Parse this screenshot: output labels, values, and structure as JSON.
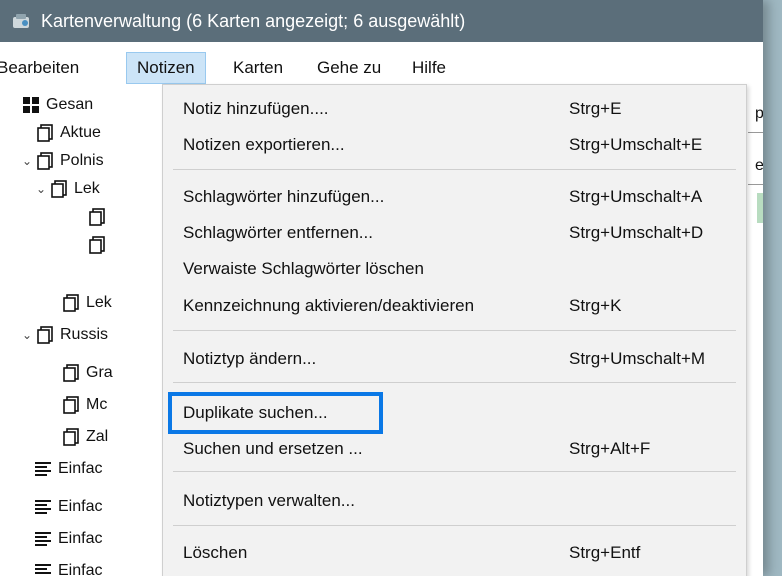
{
  "window": {
    "title": "Kartenverwaltung (6 Karten angezeigt; 6 ausgewählt)"
  },
  "menubar": {
    "items": [
      {
        "label": "Bearbeiten"
      },
      {
        "label": "Notizen"
      },
      {
        "label": "Karten"
      },
      {
        "label": "Gehe zu"
      },
      {
        "label": "Hilfe"
      }
    ]
  },
  "sidebar": {
    "items": [
      {
        "label": "Gesan",
        "icon": "grid-icon"
      },
      {
        "label": "Aktue",
        "icon": "cards-icon"
      },
      {
        "label": "Polnis",
        "icon": "cards-icon"
      },
      {
        "label": "Lek",
        "icon": "cards-icon"
      },
      {
        "label": "",
        "icon": "cards-icon"
      },
      {
        "label": "",
        "icon": "cards-icon"
      },
      {
        "label": "Lek",
        "icon": "cards-icon"
      },
      {
        "label": "Russis",
        "icon": "cards-icon"
      },
      {
        "label": "Gra",
        "icon": "cards-icon"
      },
      {
        "label": "Mc",
        "icon": "cards-icon"
      },
      {
        "label": "Zal",
        "icon": "cards-icon"
      },
      {
        "label": "Einfac",
        "icon": "notetype-icon"
      },
      {
        "label": "Einfac",
        "icon": "notetype-icon"
      },
      {
        "label": "Einfac",
        "icon": "notetype-icon"
      },
      {
        "label": "Einfac",
        "icon": "notetype-icon"
      }
    ]
  },
  "right_edge": {
    "text1": "pe",
    "text2": "elc"
  },
  "dropdown": {
    "items": [
      {
        "label": "Notiz hinzufügen....",
        "shortcut": "Strg+E"
      },
      {
        "label": "Notizen exportieren...",
        "shortcut": "Strg+Umschalt+E"
      },
      {
        "label": "Schlagwörter hinzufügen...",
        "shortcut": "Strg+Umschalt+A"
      },
      {
        "label": "Schlagwörter entfernen...",
        "shortcut": "Strg+Umschalt+D"
      },
      {
        "label": "Verwaiste Schlagwörter löschen",
        "shortcut": ""
      },
      {
        "label": "Kennzeichnung aktivieren/deaktivieren",
        "shortcut": "Strg+K"
      },
      {
        "label": "Notiztyp ändern...",
        "shortcut": "Strg+Umschalt+M"
      },
      {
        "label": "Duplikate suchen...",
        "shortcut": ""
      },
      {
        "label": "Suchen und ersetzen ...",
        "shortcut": "Strg+Alt+F"
      },
      {
        "label": "Notiztypen verwalten...",
        "shortcut": ""
      },
      {
        "label": "Löschen",
        "shortcut": "Strg+Entf"
      }
    ]
  },
  "colors": {
    "titlebar": "#5b6e7a",
    "highlight": "#0a78e6",
    "menu_active": "#cce4f7"
  }
}
